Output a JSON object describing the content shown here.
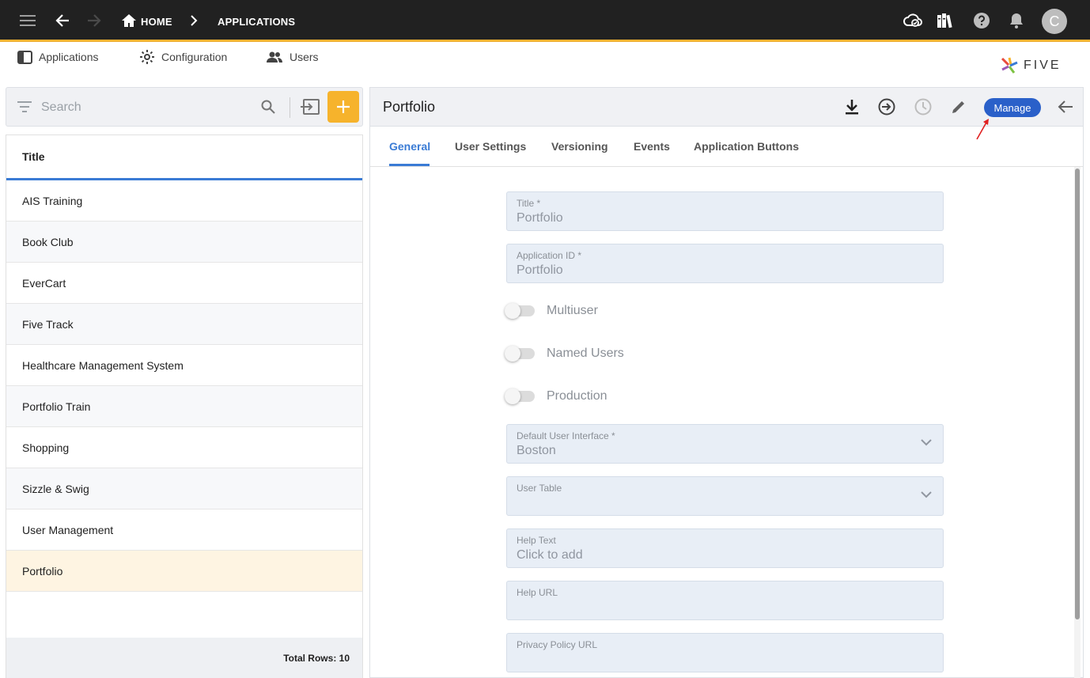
{
  "topbar": {
    "home": "HOME",
    "applications": "APPLICATIONS",
    "avatar_initial": "C"
  },
  "subnav": {
    "applications": "Applications",
    "configuration": "Configuration",
    "users": "Users"
  },
  "logo": {
    "text": "FIVE"
  },
  "left": {
    "search_placeholder": "Search",
    "column_header": "Title",
    "rows": [
      "AIS Training",
      "Book Club",
      "EverCart",
      "Five Track",
      "Healthcare Management System",
      "Portfolio Train",
      "Shopping",
      "Sizzle & Swig",
      "User Management",
      "Portfolio"
    ],
    "total_rows": "Total Rows: 10"
  },
  "right": {
    "title": "Portfolio",
    "manage_label": "Manage",
    "tabs": [
      "General",
      "User Settings",
      "Versioning",
      "Events",
      "Application Buttons"
    ],
    "fields": {
      "title_label": "Title *",
      "title_value": "Portfolio",
      "appid_label": "Application ID *",
      "appid_value": "Portfolio",
      "multiuser": "Multiuser",
      "named_users": "Named Users",
      "production": "Production",
      "ui_label": "Default User Interface *",
      "ui_value": "Boston",
      "user_table_label": "User Table",
      "help_text_label": "Help Text",
      "help_text_value": "Click to add",
      "help_url_label": "Help URL",
      "privacy_label": "Privacy Policy URL"
    }
  },
  "colors": {
    "topbar": "#212121",
    "accent_yellow": "#f6b32c",
    "accent_blue": "#3a7bd5",
    "manage_blue": "#2a60c9",
    "selected_row": "#fef4e2",
    "field_bg": "#e8eef6"
  }
}
